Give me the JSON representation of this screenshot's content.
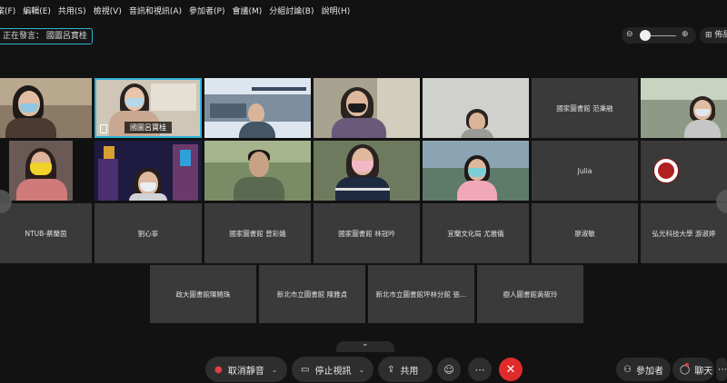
{
  "menu": [
    "案(F)",
    "編輯(E)",
    "共用(S)",
    "檢視(V)",
    "音訊和視訊(A)",
    "參加者(P)",
    "會議(M)",
    "分組討論(B)",
    "說明(H)"
  ],
  "speaking": {
    "label": "正在發言：",
    "name": "國圖呂寶桂"
  },
  "toolbar": {
    "layout_label": "佈局"
  },
  "tiles": {
    "r1": [
      "國圖呂寶桂",
      "國家圖書館 范秉融"
    ],
    "r2": [
      "Julia"
    ],
    "r3": [
      "NTUB-蔡蘭茵",
      "劉心寧",
      "國家圖書館 曾彩娥",
      "國家圖書館 林冠吟",
      "宜蘭文化局 尤雅儀",
      "廖淑敏",
      "弘光科技大學 游淑婷"
    ],
    "r4": [
      "政大圖書館陳曉珠",
      "新北市立圖書館 陳雅貞",
      "新北市立圖書館坪林分館 張…",
      "樹人圖書館黃筱玲"
    ]
  },
  "controls": {
    "mute": "取消靜音",
    "stop_video": "停止視訊",
    "share": "共用",
    "participants": "參加者",
    "chat": "聊天"
  },
  "colors": {
    "accent": "#2fb3d6",
    "end_call": "#e02b2b",
    "tile_bg": "#3a3a3a",
    "bg": "#121212"
  }
}
